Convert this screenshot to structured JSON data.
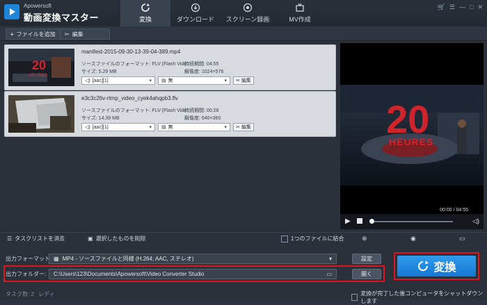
{
  "app": {
    "brand_small": "Apowersoft",
    "brand_title": "動画変換マスター",
    "accent": "#1e86d8",
    "highlight": "#e0141e"
  },
  "tabs": [
    {
      "label": "変換",
      "icon": "refresh-icon",
      "active": true
    },
    {
      "label": "ダウンロード",
      "icon": "download-icon",
      "active": false
    },
    {
      "label": "スクリーン録画",
      "icon": "record-icon",
      "active": false
    },
    {
      "label": "MV作成",
      "icon": "tv-icon",
      "active": false
    }
  ],
  "toolbar": {
    "add_file": "ファイルを追加",
    "edit": "編集"
  },
  "files": [
    {
      "name": "manifest-2015-09-30-13-39-04-389.mp4",
      "source_format_label": "ソースファイルのフォーマット: FLV (Flash Vide",
      "size_label": "サイズ: 5.29 MB",
      "duration_label": "持続期間: 04:55",
      "resolution_label": "解像度: 1024×576",
      "audio_track": "[aac][1]",
      "subtitle": "無",
      "edit_label": "編集"
    },
    {
      "name": "e3c3c26v-rtmp_video_cyek4ahqpb3.flv",
      "source_format_label": "ソースファイルのフォーマット: FLV (Flash Vide",
      "size_label": "サイズ: 14.39 MB",
      "duration_label": "持続期間: 00:28",
      "resolution_label": "解像度: 640×360",
      "audio_track": "[aac][1]",
      "subtitle": "無",
      "edit_label": "編集"
    }
  ],
  "preview": {
    "time": "00:00 / 04:55",
    "thumb_text_top": "20",
    "thumb_text_bottom": "HEURES"
  },
  "actions": {
    "clear_tasks": "タスクリストを消去",
    "delete_selected": "選択したものを削除",
    "merge_label": "1つのファイルに結合"
  },
  "output": {
    "format_label": "出力フォーマット:",
    "format_value": "MP4 - ソースファイルと同様 (H.264; AAC, ステレオ)",
    "settings_button": "設定",
    "folder_label": "出力フォルダー:",
    "folder_value": "C:\\Users\\123\\Documents\\Apowersoft\\Video Converter Studio",
    "open_button": "開く"
  },
  "convert_button": "変換",
  "status": {
    "task_count": "タスク数: 2",
    "ready": "レディ",
    "shutdown_label": "変換が完了した後コンピュータをシャットダウンします"
  }
}
